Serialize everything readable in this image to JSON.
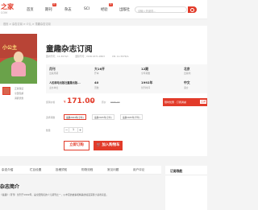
{
  "nav": {
    "logo": "之家",
    "logo_sub": "COM",
    "items": [
      {
        "label": "首页",
        "sub": ""
      },
      {
        "label": "期刊",
        "sub": "",
        "badge": "新"
      },
      {
        "label": "杂志",
        "sub": ""
      },
      {
        "label": "SCI",
        "sub": ""
      },
      {
        "label": "经验",
        "sub": "",
        "badge": "新"
      },
      {
        "label": "出版社",
        "sub": ""
      }
    ],
    "search_placeholder": "请输入关键词..."
  },
  "breadcrumb": "首页 > 杂志订阅 > 少儿 > 童趣杂志订阅",
  "product": {
    "cover_text": "小公主",
    "title": "童趣杂志订阅",
    "meta": [
      "国内刊号：11-3074/I",
      "国际刊号：ISSN 1671-9603",
      "CN: 11-3076/G"
    ],
    "side_notes": [
      "正版保证",
      "全国包邮",
      "满额优惠"
    ],
    "info": [
      {
        "value": "月刊",
        "label": "出版周期"
      },
      {
        "value": "大16开",
        "label": "开本"
      },
      {
        "value": "12期",
        "label": "全年期数"
      },
      {
        "value": "北京",
        "label": "出版地"
      },
      {
        "value": "人民邮电出版社童趣出版...",
        "label": "主办单位"
      },
      {
        "value": "40",
        "label": "页数"
      },
      {
        "value": "1992年",
        "label": "创刊时间"
      },
      {
        "value": "中文",
        "label": "语言"
      }
    ],
    "price_label": "促销价格",
    "currency": "¥",
    "price": "171.00",
    "price_unit": "/ 年",
    "orig_label": "原价",
    "orig_price": "¥180.00",
    "promo_text": "限时优惠 · 订阅满减",
    "promo_tag": "立减",
    "period_label": "选择期数",
    "periods": [
      "童趣2024年(全年)",
      "童趣2025年(全年)",
      "童趣2025年(半年)"
    ],
    "qty_label": "数量",
    "qty": "1",
    "buy_label": "立即订购",
    "cart_label": "加入购物车"
  },
  "tabs": [
    "杂志介绍",
    "栏目设置",
    "投稿须知",
    "购物流程",
    "常见问题",
    "用户评论"
  ],
  "section": {
    "title": "杂志简介",
    "intro": "《童趣》（月刊）创刊于1992年，是全国知名的少儿期刊之一，以丰富的故事和精美的插画深受小读者喜爱。"
  },
  "side": {
    "title": "订阅导航"
  }
}
